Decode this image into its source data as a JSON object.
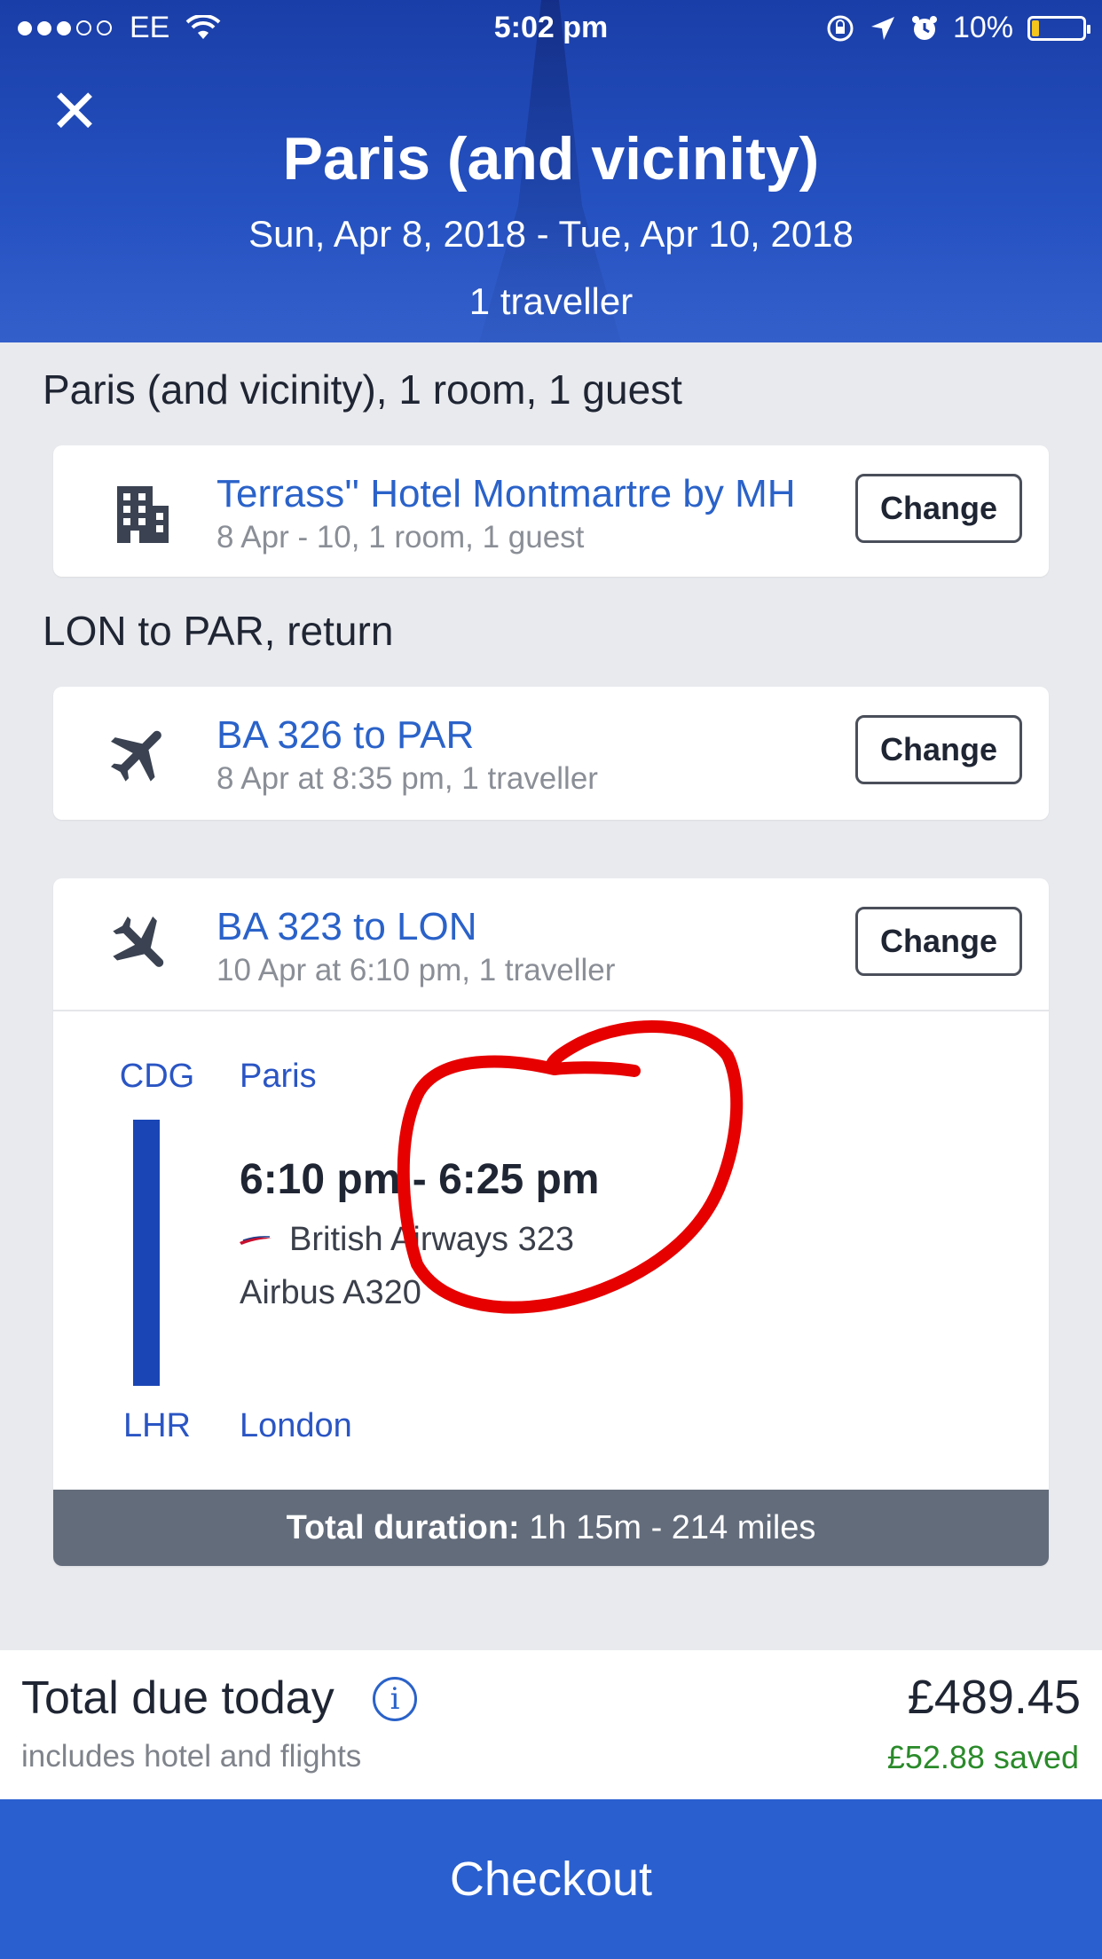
{
  "status_bar": {
    "carrier": "EE",
    "time": "5:02 pm",
    "battery": "10%"
  },
  "header": {
    "title": "Paris (and vicinity)",
    "dates": "Sun, Apr 8, 2018 - Tue, Apr 10, 2018",
    "travellers": "1 traveller",
    "close_glyph": "✕"
  },
  "hotel_section": {
    "title": "Paris (and vicinity), 1 room, 1 guest",
    "hotel": {
      "name": "Terrass'' Hotel Montmartre by MH",
      "details": "8 Apr - 10, 1 room, 1 guest",
      "change_label": "Change",
      "icon": "building-icon"
    }
  },
  "flight_section": {
    "title": "LON to PAR, return",
    "outbound": {
      "name": "BA 326 to PAR",
      "details": "8 Apr at 8:35 pm, 1 traveller",
      "change_label": "Change",
      "icon": "plane-icon"
    },
    "inbound": {
      "name": "BA 323 to LON",
      "details": "10 Apr at 6:10 pm, 1 traveller",
      "change_label": "Change",
      "icon": "plane-icon",
      "segment": {
        "from_code": "CDG",
        "from_city": "Paris",
        "to_code": "LHR",
        "to_city": "London",
        "times": "6:10 pm - 6:25 pm",
        "airline": "British Airways 323",
        "aircraft": "Airbus A320"
      },
      "duration_label": "Total duration:",
      "duration_value": "1h 15m - 214 miles"
    }
  },
  "total": {
    "label": "Total due today",
    "sub": "includes hotel and flights",
    "price": "£489.45",
    "saved": "£52.88 saved",
    "info_glyph": "i"
  },
  "checkout_label": "Checkout",
  "colors": {
    "brand_blue": "#2a5fcf",
    "link_blue": "#2a62c9",
    "saved_green": "#2a8a2a",
    "annotation_red": "#e60000"
  }
}
